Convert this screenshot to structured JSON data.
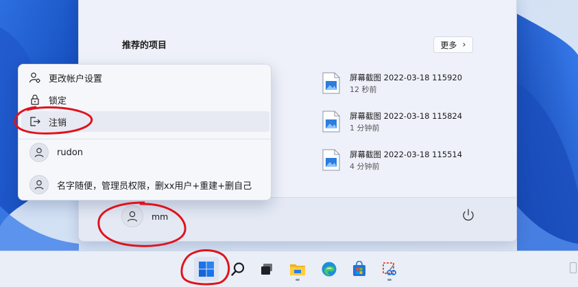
{
  "start_menu": {
    "recommended_title": "推荐的项目",
    "more_button": "更多",
    "recommended_items": [
      {
        "name": "屏幕截图 2022-03-18 115920",
        "time": "12 秒前"
      },
      {
        "name": "屏幕截图 2022-03-18 115824",
        "time": "1 分钟前"
      },
      {
        "name": "屏幕截图 2022-03-18 115514",
        "time": "4 分钟前"
      }
    ],
    "user_name": "mm"
  },
  "context_menu": {
    "items": [
      {
        "label": "更改帐户设置",
        "icon": "account-settings-icon"
      },
      {
        "label": "锁定",
        "icon": "lock-icon"
      },
      {
        "label": "注销",
        "icon": "sign-out-icon"
      }
    ],
    "accounts": [
      {
        "label": "rudon"
      },
      {
        "label": "名字随便，管理员权限，删xx用户+重建+删自己"
      }
    ]
  },
  "taskbar": {
    "icons": [
      "start-icon",
      "search-icon",
      "task-view-icon",
      "file-explorer-icon",
      "edge-icon",
      "store-icon",
      "snipping-tool-icon"
    ]
  },
  "colors": {
    "accent": "#0067c0",
    "annotation": "#e0121c"
  }
}
